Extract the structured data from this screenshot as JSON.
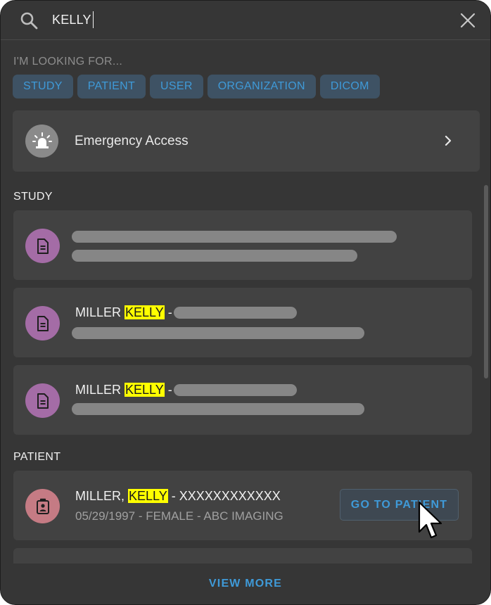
{
  "search": {
    "value": "KELLY"
  },
  "filters": {
    "label": "I'M LOOKING FOR...",
    "chips": [
      "STUDY",
      "PATIENT",
      "USER",
      "ORGANIZATION",
      "DICOM"
    ]
  },
  "emergency": {
    "label": "Emergency Access"
  },
  "study_section": {
    "title": "STUDY",
    "results": [
      {
        "placeholder": true
      },
      {
        "name_prefix": "MILLER ",
        "highlight": "KELLY",
        "name_suffix": " -"
      },
      {
        "name_prefix": "MILLER ",
        "highlight": "KELLY",
        "name_suffix": " -"
      }
    ]
  },
  "patient_section": {
    "title": "PATIENT",
    "result": {
      "name_prefix": "MILLER, ",
      "highlight": "KELLY",
      "name_suffix": " - XXXXXXXXXXXX",
      "dob": "05/29/1997",
      "gender": "FEMALE",
      "org": "ABC IMAGING",
      "sep": " - ",
      "button_label": "GO TO PATIENT"
    }
  },
  "footer": {
    "view_more": "VIEW MORE"
  },
  "colors": {
    "accent": "#3f9ad8",
    "highlight": "#ffff00",
    "study_avatar": "#a46ca6",
    "patient_avatar": "#c57b84"
  }
}
